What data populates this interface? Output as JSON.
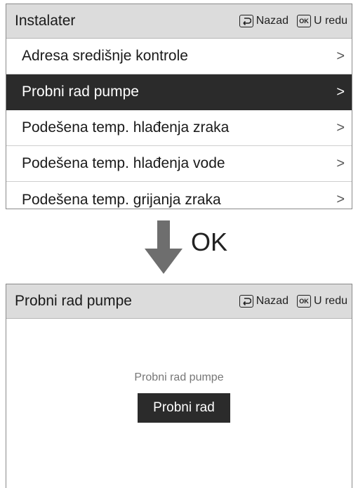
{
  "screen1": {
    "title": "Instalater",
    "back_label": "Nazad",
    "ok_label": "U redu",
    "ok_key_text": "OK",
    "menu_items": [
      {
        "label": "Adresa središnje kontrole",
        "chevron": ">"
      },
      {
        "label": "Probni rad pumpe",
        "chevron": ">",
        "selected": true
      },
      {
        "label": "Podešena temp. hlađenja zraka",
        "chevron": ">"
      },
      {
        "label": "Podešena temp. hlađenja vode",
        "chevron": ">"
      },
      {
        "label": "Podešena temp. grijanja zraka",
        "chevron": ">"
      }
    ]
  },
  "transition": {
    "label": "OK"
  },
  "screen2": {
    "title": "Probni rad pumpe",
    "back_label": "Nazad",
    "ok_label": "U redu",
    "ok_key_text": "OK",
    "caption": "Probni rad pumpe",
    "button_label": "Probni rad"
  },
  "colors": {
    "titlebar": "#dcdcdc",
    "selected_row": "#2b2b2b",
    "arrow": "#6e6e6e"
  }
}
